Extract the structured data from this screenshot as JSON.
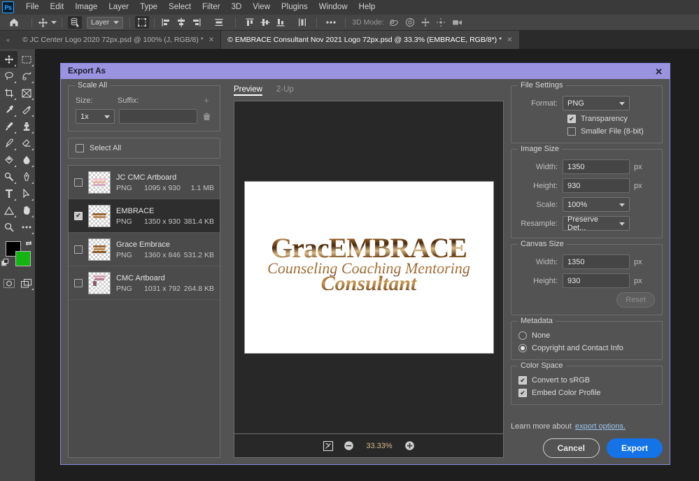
{
  "app": {
    "logo_text": "Ps",
    "menu": [
      "File",
      "Edit",
      "Image",
      "Layer",
      "Type",
      "Select",
      "Filter",
      "3D",
      "View",
      "Plugins",
      "Window",
      "Help"
    ]
  },
  "options_bar": {
    "home_icon": "home-icon",
    "move_tool_icon": "move-tool-icon",
    "auto_select_icon": "auto-select-icon",
    "layer_select_value": "Layer",
    "transform_controls_icon": "transform-controls-icon",
    "align_icons": [
      "align-left-icon",
      "align-horizontal-center-icon",
      "align-right-icon",
      "distribute-horizontal-icon"
    ],
    "align_vertical_icons": [
      "align-top-icon",
      "align-vertical-center-icon",
      "align-bottom-icon",
      "distribute-vertical-icon"
    ],
    "more_icon": "ellipsis-icon",
    "mode_label": "3D Mode:",
    "mode_icons": [
      "orbit-3d-icon",
      "roll-3d-icon",
      "pan-3d-icon",
      "slide-3d-icon",
      "camera-3d-icon"
    ]
  },
  "tabs": {
    "collapse_icon": "collapse-arrows-icon",
    "items": [
      {
        "label": "© JC Center Logo 2020 72px.psd @ 100% (J, RGB/8) *",
        "active": false,
        "close_icon": "close-icon"
      },
      {
        "label": "© EMBRACE Consultant Nov 2021 Logo 72px.psd @ 33.3% (EMBRACE, RGB/8*) *",
        "active": true,
        "close_icon": "close-icon"
      }
    ]
  },
  "toolbar": {
    "tools": [
      {
        "name": "move-tool",
        "selected": true
      },
      {
        "name": "rectangular-marquee-tool",
        "selected": false
      },
      {
        "name": "lasso-tool",
        "selected": false
      },
      {
        "name": "object-selection-tool",
        "selected": false
      },
      {
        "name": "crop-tool",
        "selected": false
      },
      {
        "name": "frame-tool",
        "selected": false
      },
      {
        "name": "eyedropper-tool",
        "selected": false
      },
      {
        "name": "spot-healing-brush-tool",
        "selected": false
      },
      {
        "name": "brush-tool",
        "selected": false
      },
      {
        "name": "clone-stamp-tool",
        "selected": false
      },
      {
        "name": "history-brush-tool",
        "selected": false
      },
      {
        "name": "eraser-tool",
        "selected": false
      },
      {
        "name": "gradient-tool",
        "selected": false
      },
      {
        "name": "blur-tool",
        "selected": false
      },
      {
        "name": "dodge-tool",
        "selected": false
      },
      {
        "name": "pen-tool",
        "selected": false
      },
      {
        "name": "type-tool",
        "selected": false
      },
      {
        "name": "path-selection-tool",
        "selected": false
      },
      {
        "name": "shape-tool",
        "selected": false
      },
      {
        "name": "hand-tool",
        "selected": false
      },
      {
        "name": "zoom-tool",
        "selected": false
      },
      {
        "name": "edit-toolbar-tool",
        "selected": false
      }
    ],
    "foreground_color": "#000000",
    "background_color": "#13b513",
    "swap_colors_icon": "swap-colors-icon",
    "default_colors_icon": "default-colors-icon",
    "quick_mask_icon": "quick-mask-icon",
    "screen_mode_icon": "screen-mode-icon"
  },
  "dialog": {
    "title": "Export As",
    "close_icon": "close-icon",
    "scale_all": {
      "legend": "Scale All",
      "size_label": "Size:",
      "size_value": "1x",
      "suffix_label": "Suffix:",
      "suffix_value": "",
      "suffix_placeholder": "",
      "add_icon": "plus-icon",
      "delete_icon": "trash-icon"
    },
    "select_all": {
      "label": "Select All",
      "checked": false
    },
    "assets": [
      {
        "name": "JC CMC Artboard",
        "format": "PNG",
        "dimensions": "1095 x 930",
        "size": "1.1 MB",
        "checked": false,
        "selected": false
      },
      {
        "name": "EMBRACE",
        "format": "PNG",
        "dimensions": "1350 x 930",
        "size": "381.4 KB",
        "checked": true,
        "selected": true
      },
      {
        "name": "Grace Embrace",
        "format": "PNG",
        "dimensions": "1360 x 846",
        "size": "531.2 KB",
        "checked": false,
        "selected": false
      },
      {
        "name": "CMC Artboard",
        "format": "PNG",
        "dimensions": "1031 x 792",
        "size": "264.8 KB",
        "checked": false,
        "selected": false
      }
    ],
    "preview": {
      "tabs": [
        {
          "label": "Preview",
          "active": true
        },
        {
          "label": "2-Up",
          "active": false
        }
      ],
      "logo": {
        "line1": "GracEMBRACE",
        "line2": "Counseling Coaching Mentoring",
        "line3": "Consultant"
      },
      "fit_icon": "fit-preview-icon",
      "zoom_out_icon": "zoom-out-icon",
      "zoom_in_icon": "zoom-in-icon",
      "zoom_value": "33.33%"
    },
    "file_settings": {
      "legend": "File Settings",
      "format_label": "Format:",
      "format_value": "PNG",
      "transparency_label": "Transparency",
      "transparency_checked": true,
      "smaller_file_label": "Smaller File (8-bit)",
      "smaller_file_checked": false
    },
    "image_size": {
      "legend": "Image Size",
      "width_label": "Width:",
      "width_value": "1350",
      "width_unit": "px",
      "height_label": "Height:",
      "height_value": "930",
      "height_unit": "px",
      "scale_label": "Scale:",
      "scale_value": "100%",
      "resample_label": "Resample:",
      "resample_value": "Preserve Det..."
    },
    "canvas_size": {
      "legend": "Canvas Size",
      "width_label": "Width:",
      "width_value": "1350",
      "width_unit": "px",
      "height_label": "Height:",
      "height_value": "930",
      "height_unit": "px",
      "reset_label": "Reset"
    },
    "metadata": {
      "legend": "Metadata",
      "none_label": "None",
      "none_selected": false,
      "copyright_label": "Copyright and Contact Info",
      "copyright_selected": true
    },
    "color_space": {
      "legend": "Color Space",
      "convert_label": "Convert to sRGB",
      "convert_checked": true,
      "embed_label": "Embed Color Profile",
      "embed_checked": true
    },
    "footer": {
      "learn_text": "Learn more about",
      "learn_link": "export options.",
      "cancel_label": "Cancel",
      "export_label": "Export"
    }
  },
  "colors": {
    "dialog_title_bg": "#9a93e0",
    "accent_blue": "#1473e6",
    "zoom_text": "#d8bb8a",
    "link": "#9cc4ef"
  }
}
